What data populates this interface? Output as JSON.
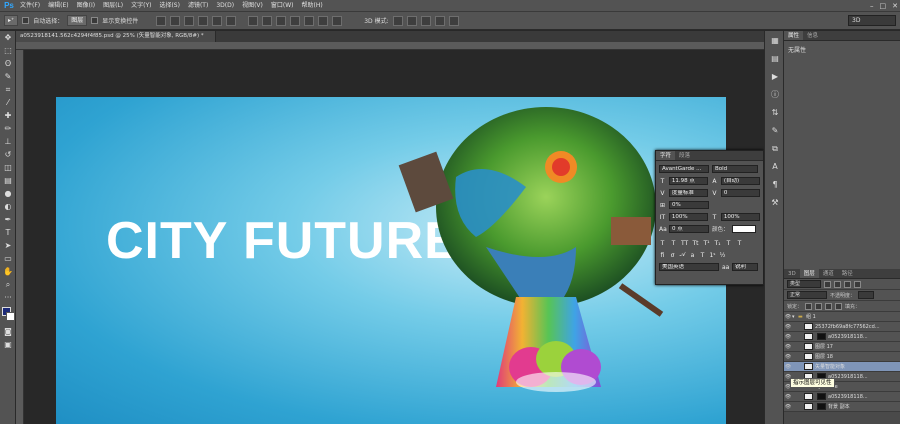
{
  "app": {
    "logo": "Ps"
  },
  "menu": [
    "文件(F)",
    "编辑(E)",
    "图像(I)",
    "图层(L)",
    "文字(Y)",
    "选择(S)",
    "滤镜(T)",
    "3D(D)",
    "视图(V)",
    "窗口(W)",
    "帮助(H)"
  ],
  "options": {
    "auto_select_label": "自动选择：",
    "auto_select_value": "图层",
    "show_transform_label": "显示变换控件",
    "mode_3d_label": "3D 模式:",
    "workspace": "3D"
  },
  "document": {
    "tab_title": "a0523918141.562c4294f4f85.psd @ 25% (矢量智能对象, RGB/8#) *",
    "art_title": "CITY FUTURE"
  },
  "properties": {
    "tabs": [
      "属性",
      "信息"
    ],
    "empty_text": "无属性"
  },
  "character": {
    "tabs": [
      "字符",
      "段落"
    ],
    "font_family": "AvantGarde ...",
    "font_style": "Bold",
    "font_size": "11.98 点",
    "leading": "(自动)",
    "kerning": "度量标准",
    "tracking": "0",
    "vscale_pct": "0%",
    "vert_scale": "100%",
    "horiz_scale": "100%",
    "baseline": "0 点",
    "color_label": "颜色：",
    "language": "美国英语",
    "antialias": "锐利"
  },
  "layers": {
    "tabs": [
      "3D",
      "图层",
      "通道",
      "路径"
    ],
    "kind_label": "类型",
    "blend_mode": "正常",
    "opacity_label": "不透明度：",
    "lock_label": "锁定：",
    "fill_label": "填充：",
    "rows": [
      {
        "name": "组 1",
        "type": "group"
      },
      {
        "name": "25372fb69a8fc77562cd...",
        "type": "layer"
      },
      {
        "name": "a0523918118...",
        "type": "mask"
      },
      {
        "name": "图层 17",
        "type": "layer"
      },
      {
        "name": "图层 18",
        "type": "layer"
      },
      {
        "name": "矢量智能对象",
        "type": "smart"
      },
      {
        "name": "a0523918118...",
        "type": "mask"
      },
      {
        "name": "city future",
        "type": "text"
      },
      {
        "name": "a0523918118...",
        "type": "mask"
      },
      {
        "name": "背景 副本",
        "type": "mask"
      }
    ],
    "tooltip": "指示图层可见性"
  }
}
